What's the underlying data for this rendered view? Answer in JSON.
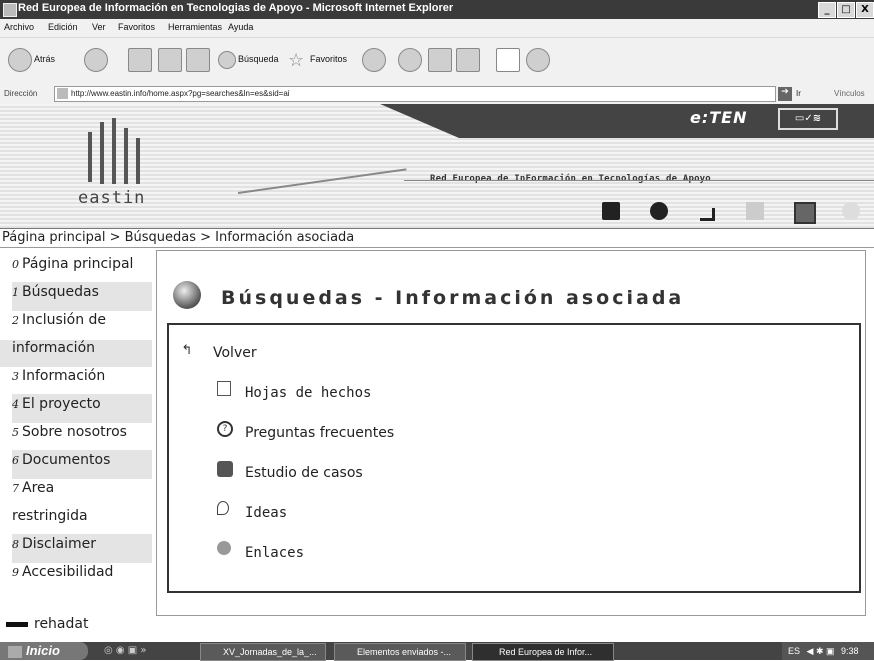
{
  "window": {
    "title": "Red Europea de Información en Tecnologias de Apoyo - Microsoft Internet Explorer",
    "minimize": "_",
    "maximize": "□",
    "close": "X"
  },
  "menu": [
    "Archivo",
    "Edición",
    "Ver",
    "Favoritos",
    "Herramientas",
    "Ayuda"
  ],
  "toolbar": {
    "back": "Atrás",
    "search": "Búsqueda",
    "favorites": "Favoritos"
  },
  "address": {
    "label": "Dirección",
    "url": "http://www.eastin.info/home.aspx?pg=searches&ln=es&sid=ai",
    "go": "Ir",
    "links": "Vínculos"
  },
  "banner": {
    "logo": "eastin",
    "eten": "e:TEN",
    "network": "Red Europea de InFormación en Tecnologías de Apoyo",
    "icons": [
      "battery-icon",
      "spiral-icon",
      "hook-icon",
      "tree-icon",
      "puzzle-icon",
      "ball-icon"
    ]
  },
  "breadcrumb": "Página principal > Búsquedas > Información asociada",
  "sidebar": {
    "items": [
      {
        "num": "0",
        "label": "Página principal"
      },
      {
        "num": "1",
        "label": "Búsquedas"
      },
      {
        "num": "2",
        "label": "Inclusión de"
      },
      {
        "num": "",
        "label": "información"
      },
      {
        "num": "3",
        "label": "Información"
      },
      {
        "num": "4",
        "label": "El proyecto"
      },
      {
        "num": "5",
        "label": "Sobre nosotros"
      },
      {
        "num": "6",
        "label": "Documentos"
      },
      {
        "num": "7",
        "label": "Area"
      },
      {
        "num": "",
        "label": "restringida"
      },
      {
        "num": "8",
        "label": "Disclaimer"
      },
      {
        "num": "9",
        "label": "Accesibilidad"
      }
    ],
    "footer": "rehadat"
  },
  "main": {
    "title": "Búsquedas - Información asociada",
    "back": "Volver",
    "links": [
      {
        "label": "Hojas de hechos",
        "icon": "document-icon"
      },
      {
        "label": "Preguntas frecuentes",
        "icon": "question-icon"
      },
      {
        "label": "Estudio de casos",
        "icon": "people-icon"
      },
      {
        "label": "Ideas",
        "icon": "bulb-icon"
      },
      {
        "label": "Enlaces",
        "icon": "globe-person-icon"
      }
    ]
  },
  "taskbar": {
    "start": "Inicio",
    "tasks": [
      "XV_Jornadas_de_la_...",
      "Elementos enviados -...",
      "Red Europea de Infor..."
    ],
    "lang": "ES",
    "time": "9:38"
  }
}
